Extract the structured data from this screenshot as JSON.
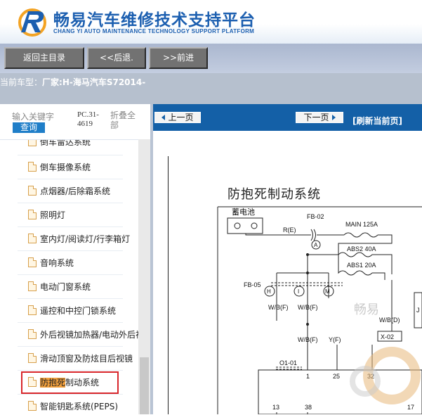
{
  "header": {
    "title": "畅易汽车维修技术支持平台",
    "subtitle": "CHANG YI AUTO MAINTENANCE TECHNOLOGY SUPPORT PLATFORM"
  },
  "nav": {
    "home": "返回主目录",
    "back": "<<后退.",
    "forward": ">>前进"
  },
  "vehicle": {
    "label": "当前车型：",
    "value": "厂家:H-海马汽车S72014-"
  },
  "search": {
    "placeholder": "输入关键字",
    "button": "查询",
    "code": "PC.31-4619",
    "collapse": "折叠全部"
  },
  "tree": {
    "items": [
      {
        "label": "倒车雷达系统"
      },
      {
        "label": "倒车摄像系统"
      },
      {
        "label": "点烟器/后除霜系统"
      },
      {
        "label": "照明灯"
      },
      {
        "label": "室内灯/阅读灯/行李箱灯"
      },
      {
        "label": "音响系统"
      },
      {
        "label": "电动门窗系统"
      },
      {
        "label": "遥控和中控门锁系统"
      },
      {
        "label": "外后视镜加热器/电动外后视镜"
      },
      {
        "label": "滑动顶窗及防炫目后视镜"
      },
      {
        "label_hl": "防抱死",
        "label_rest": "制动系统"
      },
      {
        "label": "智能钥匙系统(PEPS)"
      }
    ]
  },
  "doc": {
    "prev": "上一页",
    "next": "下一页",
    "refresh": "[刷新当前页]",
    "diagram_title": "防抱死制动系统",
    "labels": {
      "battery": "蓄电池",
      "fb02": "FB-02",
      "main": "MAIN 125A",
      "re": "R(E)",
      "a": "A",
      "abs2": "ABS2 40A",
      "abs1": "ABS1 20A",
      "fb05": "FB-05",
      "h": "H",
      "i": "I",
      "m": "M",
      "wbf1": "W/B(F)",
      "wbf2": "W/B(F)",
      "wbd": "W/B(D)",
      "wbf3": "W/B(F)",
      "yf": "Y(F)",
      "x02": "X-02",
      "o101": "O1-01",
      "p1": "1",
      "p25": "25",
      "p32": "32",
      "p13": "13",
      "p38": "38",
      "p17": "17",
      "jside": "J"
    },
    "watermark": "畅易"
  }
}
